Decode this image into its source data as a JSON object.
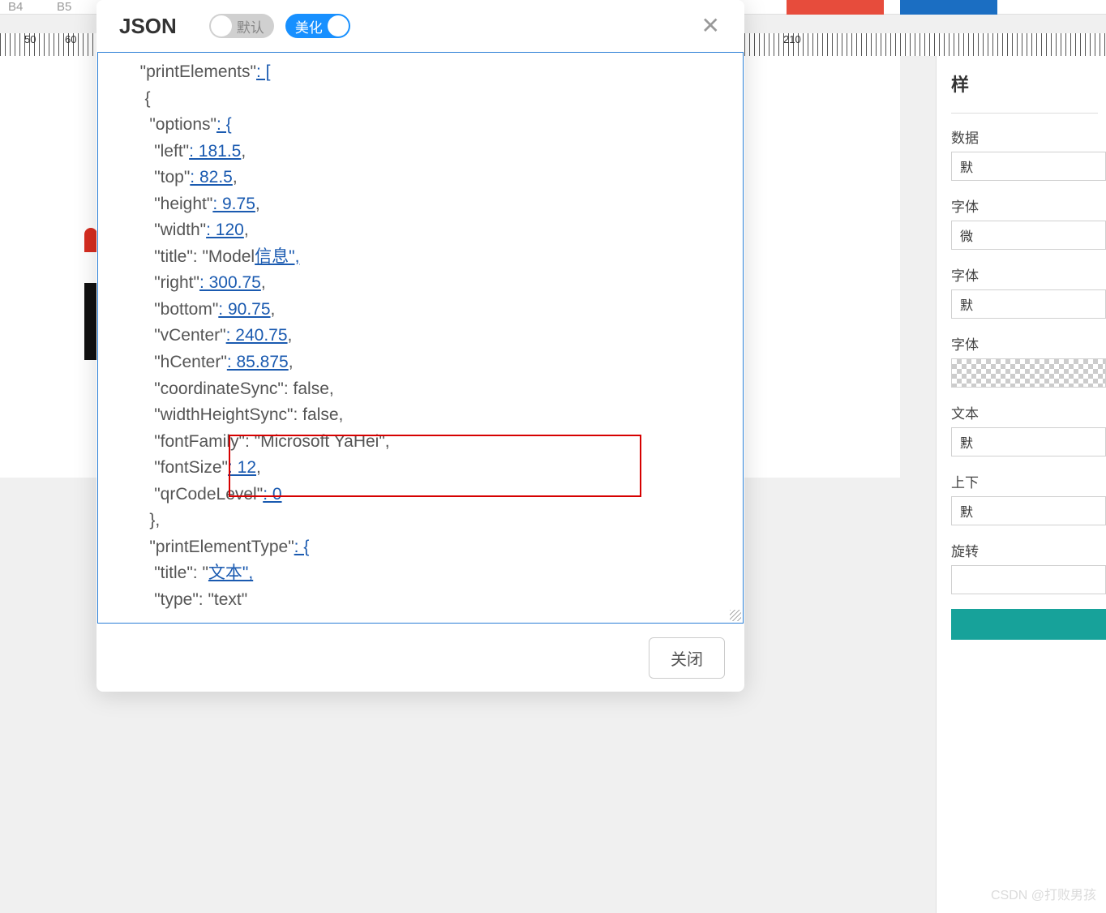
{
  "toolbar": {
    "b4": "B4",
    "b5": "B5"
  },
  "ruler": {
    "ticks": [
      {
        "label": "50",
        "pos": 30
      },
      {
        "label": "60",
        "pos": 80
      },
      {
        "label": "210",
        "pos": 966
      }
    ]
  },
  "side": {
    "title": "样",
    "data_label": "数据",
    "data_value": "默",
    "font_label": "字体",
    "font_value": "微",
    "font2_label": "字体",
    "font2_value": "默",
    "font3_label": "字体",
    "text_label": "文本",
    "text_value": "默",
    "valign_label": "上下",
    "valign_value": "默",
    "rotate_label": "旋转"
  },
  "modal": {
    "title": "JSON",
    "toggle_default": "默认",
    "toggle_beautify": "美化",
    "close_button": "关闭"
  },
  "json_data": {
    "line1_key": "\"printElements\"",
    "line1_val": ": [",
    "line2": "{",
    "line3_key": "\"options\"",
    "line3_val": ": {",
    "left_key": "\"left\"",
    "left_val": ": 181.5",
    "top_key": "\"top\"",
    "top_val": ": 82.5",
    "height_key": "\"height\"",
    "height_val": ": 9.75",
    "width_key": "\"width\"",
    "width_val": ": 120",
    "title_key": "\"title\": \"Model",
    "title_val": "信息\",",
    "right_key": "\"right\"",
    "right_val": ": 300.75",
    "bottom_key": "\"bottom\"",
    "bottom_val": ": 90.75",
    "vcenter_key": "\"vCenter\"",
    "vcenter_val": ": 240.75",
    "hcenter_key": "\"hCenter\"",
    "hcenter_val": ": 85.875",
    "coord_key": "\"coordinateSync\": false,",
    "whsync_key": "\"widthHeightSync\": false,",
    "fontfamily_key": "\"fontFamily\": \"Microsoft YaHei\",",
    "fontsize_key": "\"fontSize\"",
    "fontsize_val": ": 12",
    "qr_key": "\"qrCodeLevel\"",
    "qr_val": ": 0",
    "close_brace": "},",
    "pet_key": "\"printElementType\"",
    "pet_val": ": {",
    "pet_title_key": "\"title\": \"",
    "pet_title_val": "文本\",",
    "pet_type_key": "\"type\": \"text\""
  },
  "watermark": "CSDN @打败男孩"
}
